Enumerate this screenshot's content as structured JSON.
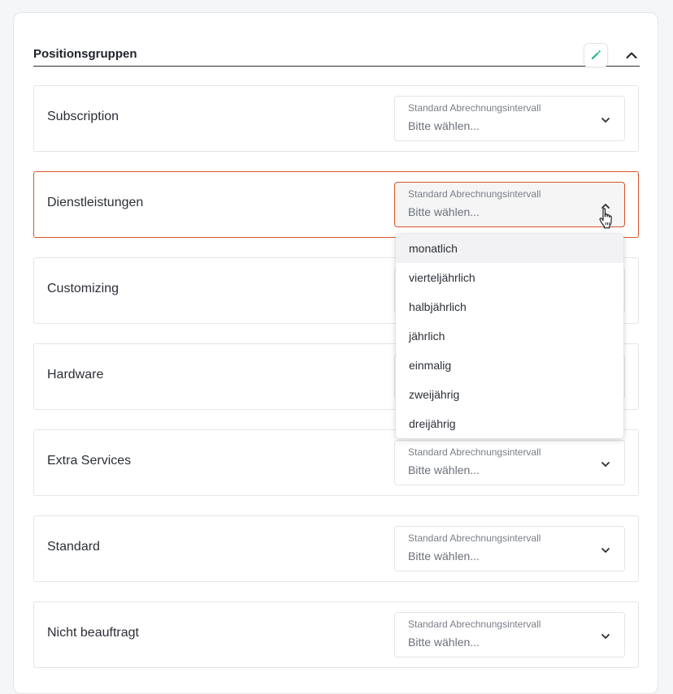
{
  "panel": {
    "title": "Positionsgruppen",
    "edit_icon": "pencil-icon",
    "collapse_icon": "chevron-up-icon",
    "accent_color": "#1fb58f",
    "active_border_color": "#d9532c"
  },
  "select_caption": "Standard Abrechnungsintervall",
  "select_placeholder": "Bitte wählen...",
  "rows": [
    {
      "label": "Subscription"
    },
    {
      "label": "Dienstleistungen",
      "state": "open"
    },
    {
      "label": "Customizing"
    },
    {
      "label": "Hardware"
    },
    {
      "label": "Extra Services"
    },
    {
      "label": "Standard"
    },
    {
      "label": "Nicht beauftragt"
    }
  ],
  "dropdown": {
    "options": [
      "monatlich",
      "vierteljährlich",
      "halbjährlich",
      "jährlich",
      "einmalig",
      "zweijährig",
      "dreijährig"
    ],
    "hovered": "monatlich"
  }
}
